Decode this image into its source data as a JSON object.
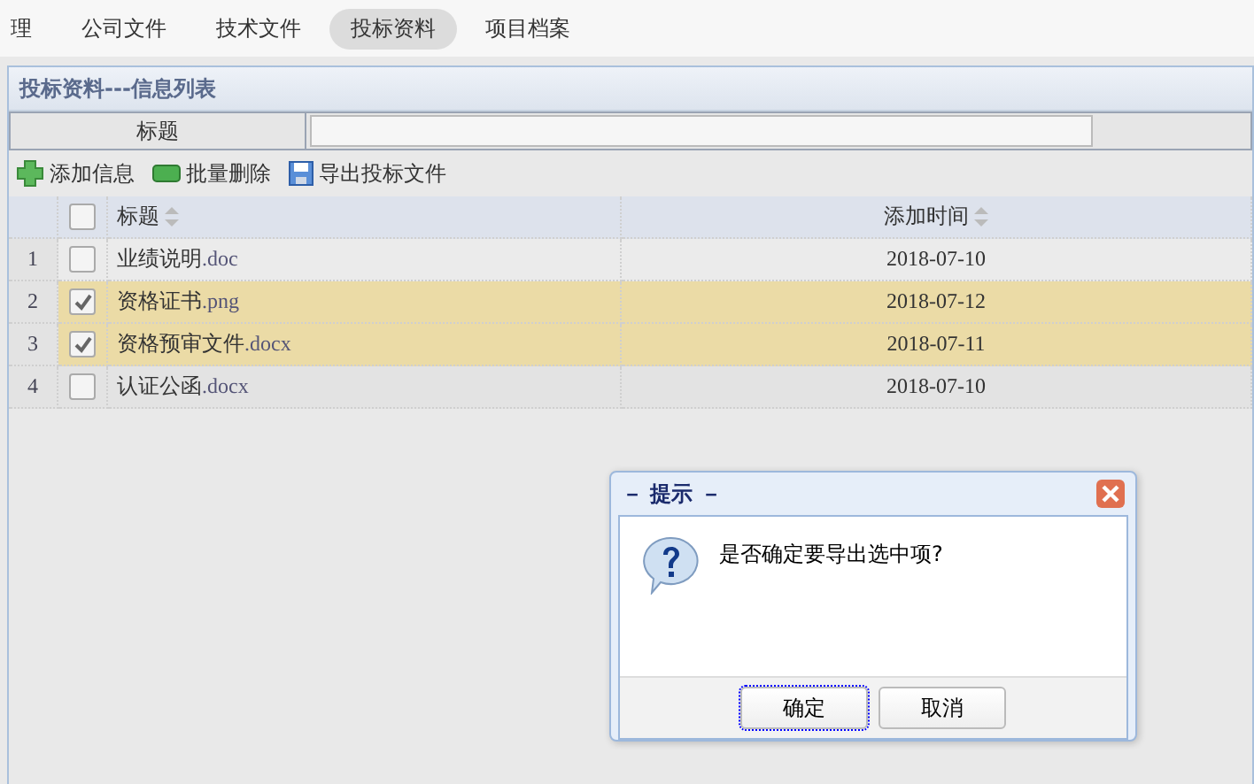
{
  "nav": [
    {
      "label": "理",
      "selected": false
    },
    {
      "label": "公司文件",
      "selected": false
    },
    {
      "label": "技术文件",
      "selected": false
    },
    {
      "label": "投标资料",
      "selected": true
    },
    {
      "label": "项目档案",
      "selected": false
    }
  ],
  "panel": {
    "title": "投标资料---信息列表"
  },
  "search": {
    "label": "标题"
  },
  "toolbar": [
    {
      "kind": "add",
      "label": "添加信息"
    },
    {
      "kind": "delete",
      "label": "批量删除"
    },
    {
      "kind": "export",
      "label": "导出投标文件"
    }
  ],
  "table": {
    "columns": [
      "标题",
      "添加时间"
    ],
    "all_checked": false,
    "rows": [
      {
        "num": "1",
        "name": "业绩说明",
        "ext": ".doc",
        "date": "2018-07-10",
        "selected": false
      },
      {
        "num": "2",
        "name": "资格证书",
        "ext": ".png",
        "date": "2018-07-12",
        "selected": true
      },
      {
        "num": "3",
        "name": "资格预审文件",
        "ext": ".docx",
        "date": "2018-07-11",
        "selected": true
      },
      {
        "num": "4",
        "name": "认证公函",
        "ext": ".docx",
        "date": "2018-07-10",
        "selected": false
      }
    ]
  },
  "dialog": {
    "title": "－ 提示 －",
    "message": "是否确定要导出选中项?",
    "buttons": [
      "确定",
      "取消"
    ]
  }
}
